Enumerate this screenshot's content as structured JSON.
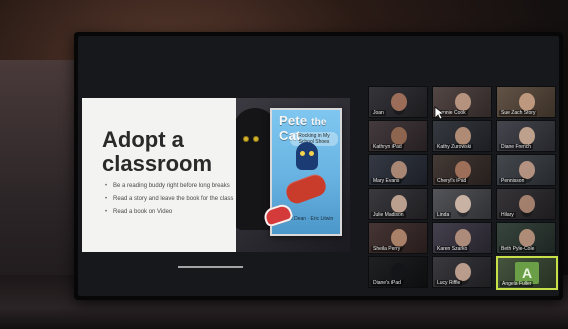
{
  "slide": {
    "title": "Adopt a\nclassroom",
    "bullets": [
      "Be a reading buddy right before long breaks",
      "Read a story and leave the book for the class",
      "Read a book on Video"
    ],
    "book": {
      "title_line1": "Pete",
      "title_line2": "Cat",
      "subtitle": "Rocking in My School Shoes",
      "author_credit": "James Dean · Eric Litwin"
    },
    "progress_fraction": 0.18
  },
  "participants": [
    {
      "name": "Joan",
      "bg": "#2b2a2f",
      "skin": "#b07a62"
    },
    {
      "name": "Bonnie Cook",
      "bg": "#4a3d3b",
      "skin": "#caa38b"
    },
    {
      "name": "Sue Zach Story",
      "bg": "#5a4a3c",
      "skin": "#d2a88b"
    },
    {
      "name": "Kathryn iPad",
      "bg": "#3a3033",
      "skin": "#9e6f55"
    },
    {
      "name": "Kathy Zurowski",
      "bg": "#2b2e35",
      "skin": "#c79c82"
    },
    {
      "name": "Diane French",
      "bg": "#3b3b44",
      "skin": "#d6b49b"
    },
    {
      "name": "Mary Evans",
      "bg": "#2a2f3a",
      "skin": "#c09780"
    },
    {
      "name": "Cheryl's iPad",
      "bg": "#3a2f2b",
      "skin": "#b07b62"
    },
    {
      "name": "Pennisson",
      "bg": "#3a3f45",
      "skin": "#caa18c"
    },
    {
      "name": "Julie Madison",
      "bg": "#2f2f34",
      "skin": "#d4b39f"
    },
    {
      "name": "Linda",
      "bg": "#4a4b50",
      "skin": "#e0c6b4"
    },
    {
      "name": "Hilary",
      "bg": "#2c2a2e",
      "skin": "#b88f79"
    },
    {
      "name": "Sheila Perry",
      "bg": "#3c2b2a",
      "skin": "#bd8f73"
    },
    {
      "name": "Karen Szarko",
      "bg": "#3a3644",
      "skin": "#c29b86"
    },
    {
      "name": "Beth Pyle-Cole",
      "bg": "#2d3a34",
      "skin": "#c69b83"
    },
    {
      "name": "Diane's iPad",
      "bg": "#141518",
      "skin": "#141518"
    },
    {
      "name": "Lucy Riffle",
      "bg": "#2f2f34",
      "skin": "#d2b09c"
    },
    {
      "name": "Angela Fuller",
      "bg": "#3b4a34",
      "skin": "#3b4a34",
      "avatar_letter": "A",
      "highlighted": true
    }
  ],
  "colors": {
    "highlight": "#c7e04a"
  },
  "icons": {
    "cursor": "mouse-pointer-icon"
  }
}
